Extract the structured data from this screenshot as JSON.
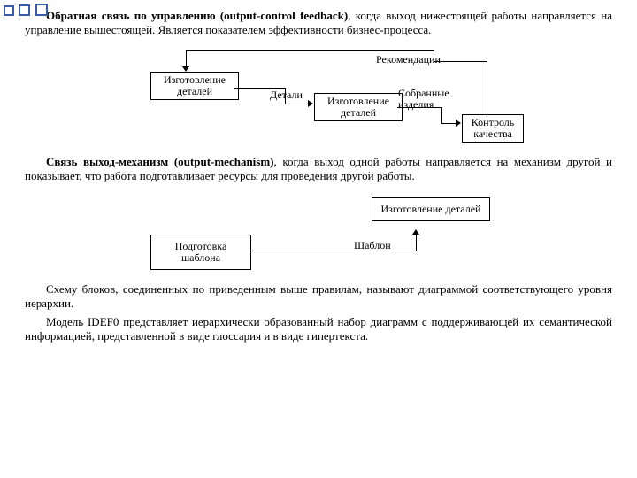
{
  "bullets": {
    "count": 3
  },
  "para1": {
    "title": "Обратная связь по управлению (output-control feedback)",
    "rest": ", когда выход нижестоящей работы направляется на управление вышестоящей. Является показателем эффективности бизнес-процесса."
  },
  "diagram1": {
    "box1": "Изготовление деталей",
    "box2": "Изготовление деталей",
    "box3": "Контроль качества",
    "label_rec": "Рекомендации",
    "label_det": "Детали",
    "label_sob": "Собранные изделия"
  },
  "para2": {
    "title": "Связь выход-механизм (output-mechanism)",
    "rest": ", когда выход одной работы направляется на механизм другой и показывает, что работа подготавливает ресурсы для проведения другой работы."
  },
  "diagram2": {
    "box1": "Подготовка шаблона",
    "box2": "Изготовление деталей",
    "label_sh": "Шаблон"
  },
  "para3": "Схему блоков, соединенных по приведенным выше правилам, называют диаграммой соответствующего уровня иерархии.",
  "para4": "Модель IDEF0 представляет иерархически образованный набор диаграмм с поддерживающей их семантической информацией, представленной в виде глоссария и в виде гипертекста."
}
